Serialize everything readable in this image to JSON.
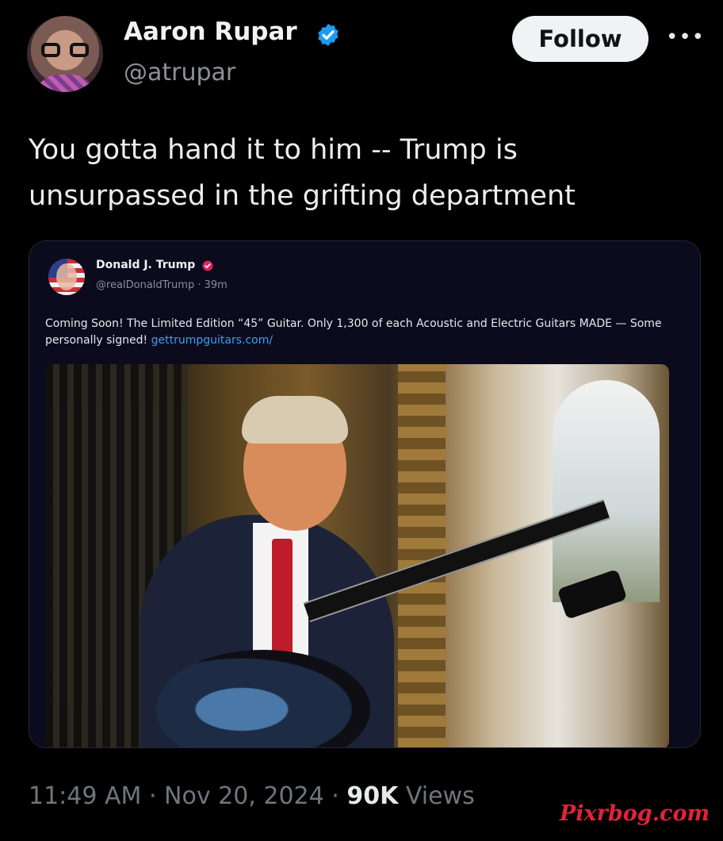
{
  "author": {
    "name": "Aaron Rupar",
    "handle": "@atrupar",
    "verified": true
  },
  "actions": {
    "follow_label": "Follow",
    "more_label": "•••"
  },
  "tweet": {
    "text_line1": "You gotta hand it to him -- Trump is",
    "text_line2": "unsurpassed in the grifting department"
  },
  "quoted_post": {
    "name": "Donald J. Trump",
    "handle_time": "@realDonaldTrump · 39m",
    "text": "Coming Soon! The Limited Edition “45” Guitar. Only 1,300 of each Acoustic and Electric Guitars MADE — Some personally signed! ",
    "link": "gettrumpguitars.com/"
  },
  "meta": {
    "time": "11:49 AM",
    "date": "Nov 20, 2024",
    "views_count": "90K",
    "views_label": "Views"
  },
  "watermark": "Pixrbog.com",
  "colors": {
    "background": "#000000",
    "verified_blue": "#1d9bf0",
    "link_blue": "#3d9ef0",
    "watermark_red": "#e1233a"
  },
  "icons": [
    "verified-badge-icon",
    "more-options-icon",
    "quoted-verified-badge-icon"
  ]
}
